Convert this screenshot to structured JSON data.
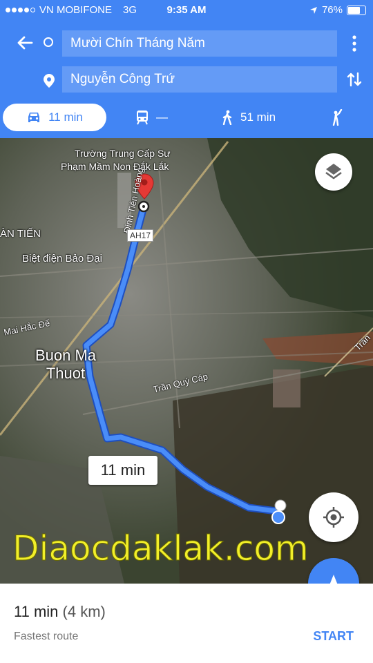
{
  "status_bar": {
    "carrier": "VN MOBIFONE",
    "network": "3G",
    "time": "9:35 AM",
    "battery": "76%",
    "battery_level": 0.76
  },
  "directions": {
    "origin": "Mười Chín Tháng Năm",
    "destination": "Nguyễn Công Trứ"
  },
  "modes": {
    "drive": "11 min",
    "transit": "—",
    "walk": "51 min"
  },
  "map": {
    "labels": {
      "school": "Trường Trung Cấp Sư Phạm Mầm Non Đắk Lắk",
      "an_tien": "ÀN TIẾN",
      "biet_dien": "Biệt điện Bảo Đại",
      "mai_hac_de": "Mai Hắc Đế",
      "city": "Buon Ma Thuot",
      "dinh_tien_hoang": "Đinh Tiên Hoàng",
      "tran_quy_cap": "Trần Quý Cáp",
      "tran": "Trần",
      "highway": "AH17"
    },
    "route_time": "11 min",
    "watermark": "Diaocdaklak.com"
  },
  "bottom_sheet": {
    "duration": "11 min",
    "distance": "(4 km)",
    "subtitle": "Fastest route",
    "start_label": "START"
  },
  "colors": {
    "accent": "#4285f4",
    "route": "#4a8df8",
    "destination_pin": "#e53935"
  }
}
